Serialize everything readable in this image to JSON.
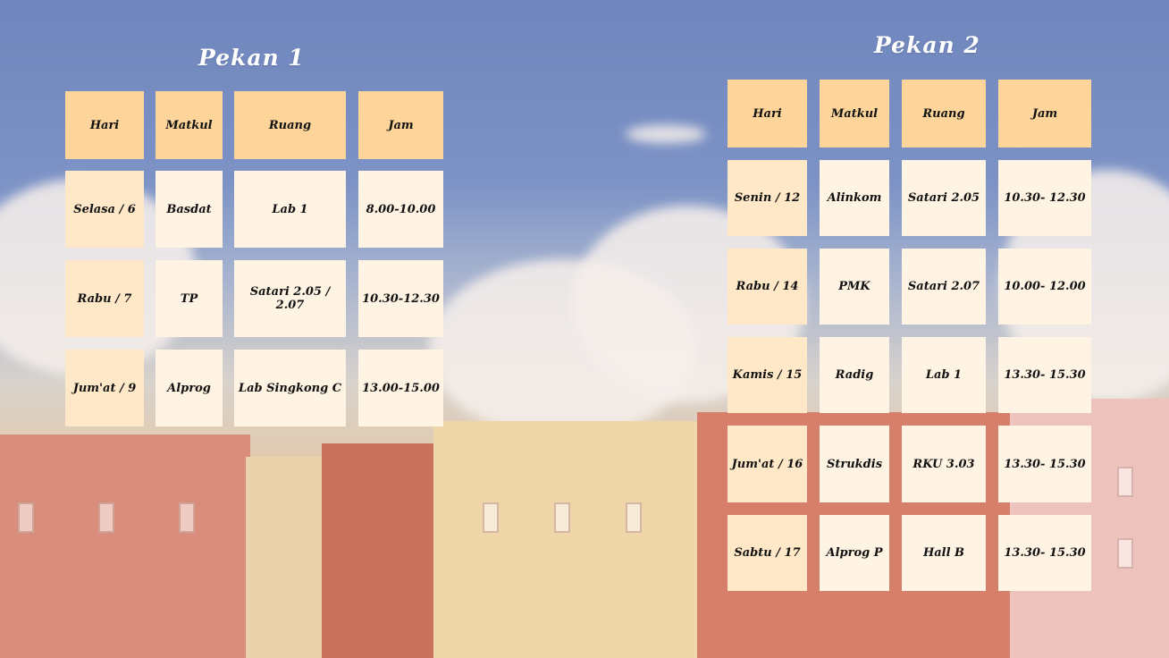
{
  "colors": {
    "header": "#fdd59a",
    "cell_light": "#fff3e3",
    "cell_mid": "#ffe8c8",
    "title": "#ffffff"
  },
  "week1": {
    "title": "Pekan 1",
    "headers": [
      "Hari",
      "Matkul",
      "Ruang",
      "Jam"
    ],
    "rows": [
      [
        "Selasa / 6",
        "Basdat",
        "Lab 1",
        "8.00-10.00"
      ],
      [
        "Rabu / 7",
        "TP",
        "Satari 2.05 / 2.07",
        "10.30-12.30"
      ],
      [
        "Jum'at / 9",
        "Alprog",
        "Lab Singkong C",
        "13.00-15.00"
      ]
    ]
  },
  "week2": {
    "title": "Pekan 2",
    "headers": [
      "Hari",
      "Matkul",
      "Ruang",
      "Jam"
    ],
    "rows": [
      [
        "Senin / 12",
        "Alinkom",
        "Satari 2.05",
        "10.30-  12.30"
      ],
      [
        "Rabu / 14",
        "PMK",
        "Satari 2.07",
        "10.00-  12.00"
      ],
      [
        "Kamis / 15",
        "Radig",
        "Lab 1",
        "13.30-  15.30"
      ],
      [
        "Jum'at / 16",
        "Strukdis",
        "RKU 3.03",
        "13.30-  15.30"
      ],
      [
        "Sabtu / 17",
        "Alprog P",
        "Hall B",
        "13.30-  15.30"
      ]
    ]
  }
}
